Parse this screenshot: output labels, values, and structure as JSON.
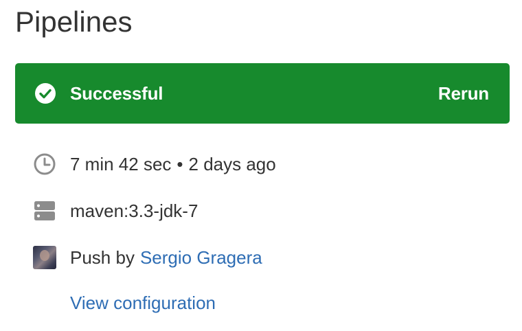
{
  "page": {
    "title": "Pipelines"
  },
  "status": {
    "label": "Successful",
    "rerun_label": "Rerun",
    "icon": "check-circle-icon",
    "color": "#178a2d"
  },
  "details": {
    "duration": "7 min 42 sec",
    "separator": "•",
    "time_ago": "2 days ago",
    "image": "maven:3.3-jdk-7",
    "push_prefix": "Push by",
    "author": "Sergio Gragera",
    "view_config_label": "View configuration"
  },
  "colors": {
    "link": "#2e6db4",
    "text": "#333333",
    "icon_gray": "#8c8c8c"
  }
}
